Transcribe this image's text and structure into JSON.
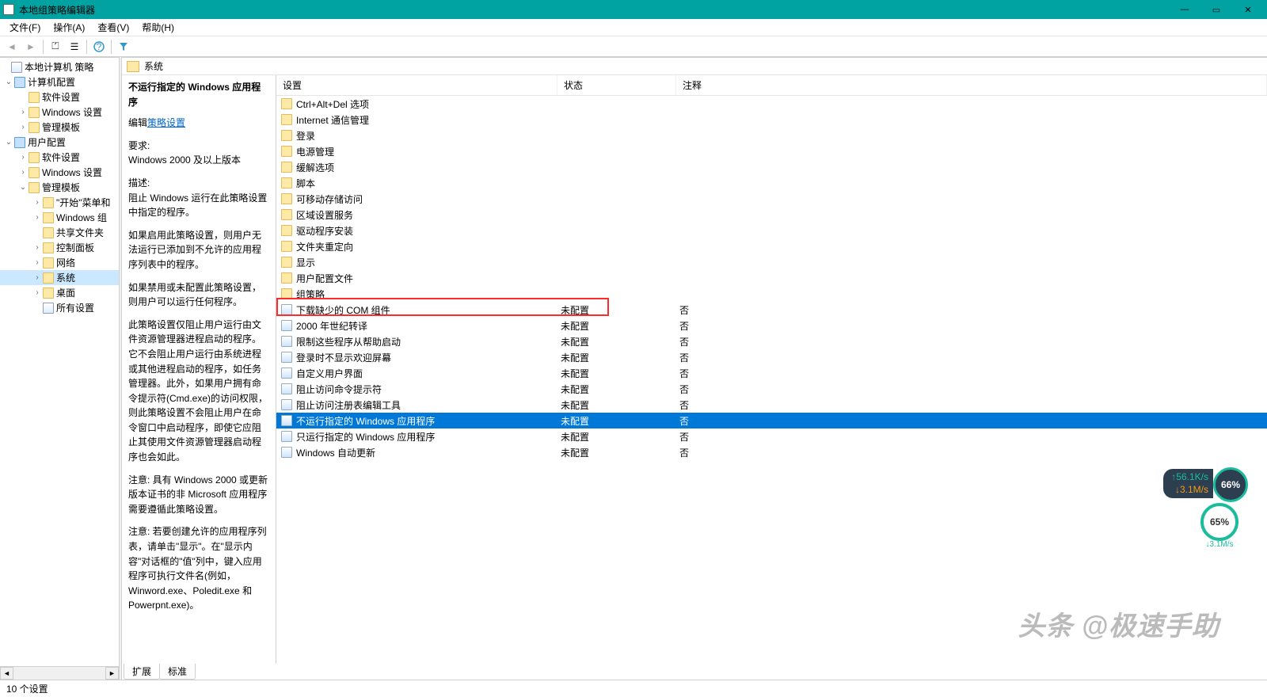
{
  "window": {
    "title": "本地组策略编辑器"
  },
  "menu": {
    "file": "文件(F)",
    "action": "操作(A)",
    "view": "查看(V)",
    "help": "帮助(H)"
  },
  "tree": {
    "root": "本地计算机 策略",
    "computer_cfg": "计算机配置",
    "cc_software": "软件设置",
    "cc_windows": "Windows 设置",
    "cc_templates": "管理模板",
    "user_cfg": "用户配置",
    "uc_software": "软件设置",
    "uc_windows": "Windows 设置",
    "uc_templates": "管理模板",
    "start": "\"开始\"菜单和",
    "wincomp": "Windows 组",
    "shared": "共享文件夹",
    "control": "控制面板",
    "network": "网络",
    "system": "系统",
    "desktop": "桌面",
    "all": "所有设置"
  },
  "location_title": "系统",
  "desc": {
    "heading": "不运行指定的 Windows 应用程序",
    "edit_prefix": "编辑",
    "edit_link": "策略设置",
    "req_label": "要求:",
    "req_value": "Windows 2000 及以上版本",
    "desc_label": "描述:",
    "p1": "阻止 Windows 运行在此策略设置中指定的程序。",
    "p2": "如果启用此策略设置，则用户无法运行已添加到不允许的应用程序列表中的程序。",
    "p3": "如果禁用或未配置此策略设置，则用户可以运行任何程序。",
    "p4": "此策略设置仅阻止用户运行由文件资源管理器进程启动的程序。它不会阻止用户运行由系统进程或其他进程启动的程序，如任务管理器。此外，如果用户拥有命令提示符(Cmd.exe)的访问权限，则此策略设置不会阻止用户在命令窗口中启动程序，即使它应阻止其使用文件资源管理器启动程序也会如此。",
    "p5": "注意: 具有 Windows 2000 或更新版本证书的非 Microsoft 应用程序需要遵循此策略设置。",
    "p6": "注意: 若要创建允许的应用程序列表，请单击\"显示\"。在\"显示内容\"对话框的\"值\"列中，键入应用程序可执行文件名(例如，Winword.exe、Poledit.exe 和 Powerpnt.exe)。"
  },
  "columns": {
    "name": "设置",
    "state": "状态",
    "comment": "注释"
  },
  "folders": [
    "Ctrl+Alt+Del 选项",
    "Internet 通信管理",
    "登录",
    "电源管理",
    "缓解选项",
    "脚本",
    "可移动存储访问",
    "区域设置服务",
    "驱动程序安装",
    "文件夹重定向",
    "显示",
    "用户配置文件",
    "组策略"
  ],
  "policies": [
    {
      "name": "下载缺少的 COM 组件",
      "state": "未配置",
      "comment": "否"
    },
    {
      "name": "2000 年世纪转译",
      "state": "未配置",
      "comment": "否"
    },
    {
      "name": "限制这些程序从帮助启动",
      "state": "未配置",
      "comment": "否"
    },
    {
      "name": "登录时不显示欢迎屏幕",
      "state": "未配置",
      "comment": "否"
    },
    {
      "name": "自定义用户界面",
      "state": "未配置",
      "comment": "否"
    },
    {
      "name": "阻止访问命令提示符",
      "state": "未配置",
      "comment": "否"
    },
    {
      "name": "阻止访问注册表编辑工具",
      "state": "未配置",
      "comment": "否"
    },
    {
      "name": "不运行指定的 Windows 应用程序",
      "state": "未配置",
      "comment": "否",
      "selected": true
    },
    {
      "name": "只运行指定的 Windows 应用程序",
      "state": "未配置",
      "comment": "否"
    },
    {
      "name": "Windows 自动更新",
      "state": "未配置",
      "comment": "否"
    }
  ],
  "tabs": {
    "extended": "扩展",
    "standard": "标准"
  },
  "status": "10 个设置",
  "overlay": {
    "gauge1": "66%",
    "up": "↑56.1K/s",
    "down": "↓3.1M/s",
    "gauge2": "65%",
    "gauge2_sub": "↓3.1M/s"
  },
  "watermark": "头条 @极速手助"
}
